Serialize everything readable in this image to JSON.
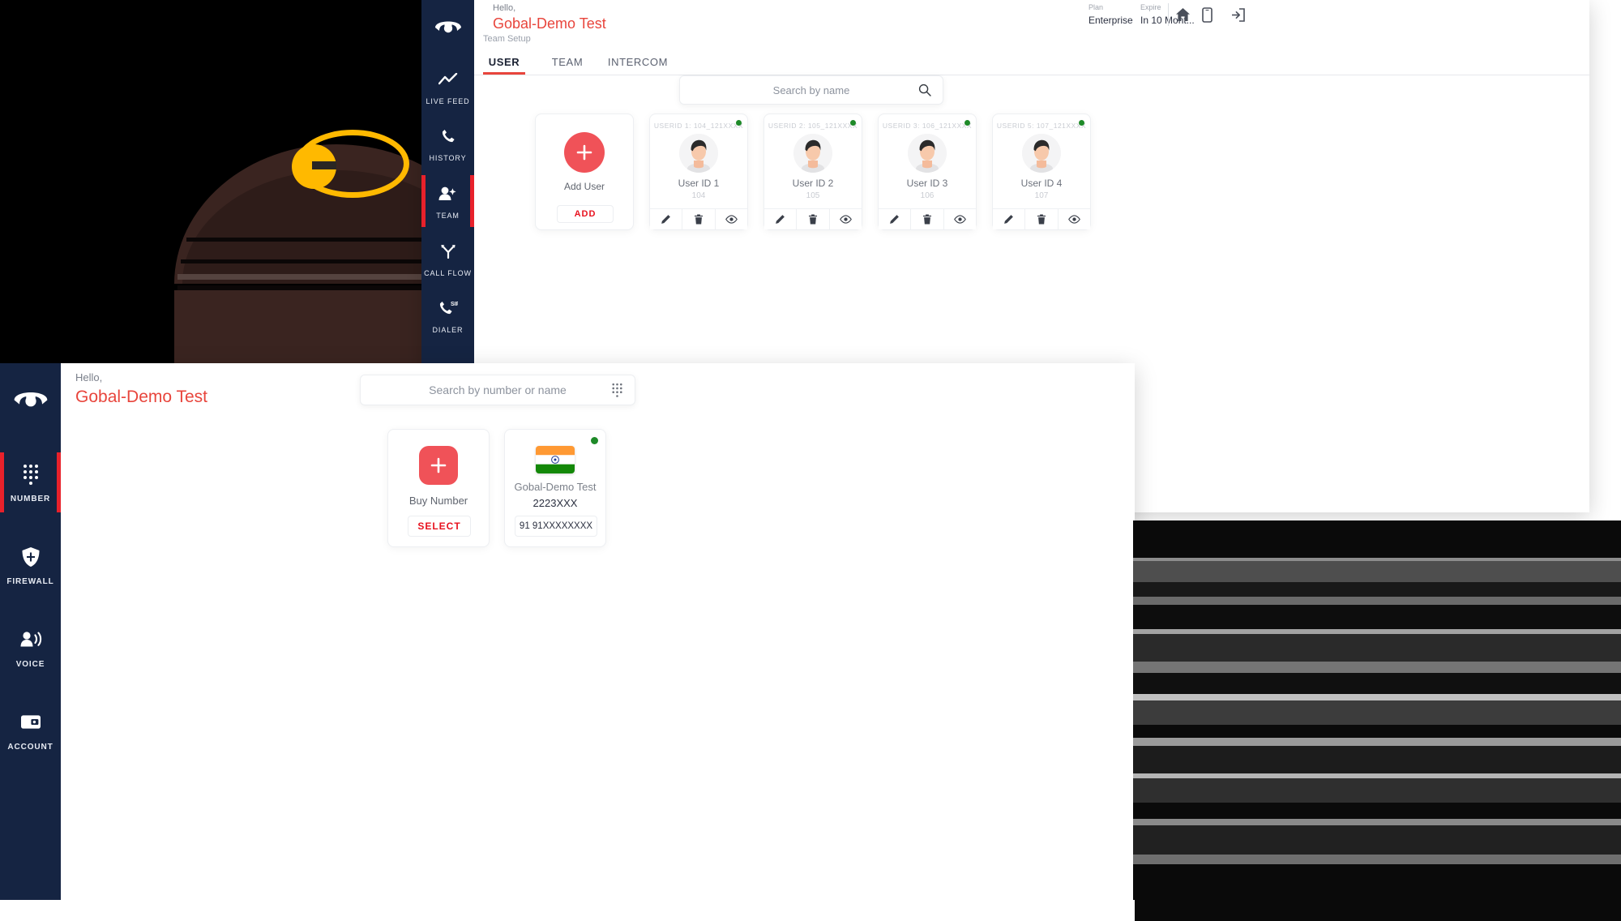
{
  "background_window": {
    "sidebar": {
      "logo_icon": "phone-hangup-icon",
      "items": [
        {
          "label": "LIVE FEED",
          "icon": "chart-line-icon",
          "active": false
        },
        {
          "label": "HISTORY",
          "icon": "phone-icon",
          "active": false
        },
        {
          "label": "TEAM",
          "icon": "user-add-icon",
          "active": true
        },
        {
          "label": "CALL FLOW",
          "icon": "call-flow-icon",
          "active": false
        },
        {
          "label": "DIALER",
          "icon": "sip-phone-icon",
          "active": false
        }
      ]
    },
    "header": {
      "greeting": "Hello,",
      "account_name": "Gobal-Demo Test",
      "plan_label": "Plan",
      "plan_value": "Enterprise",
      "expire_label": "Expire",
      "expire_value": "In 10 Mont...",
      "icons": [
        "home-icon",
        "mobile-icon",
        "logout-icon"
      ]
    },
    "section_label": "Team Setup",
    "tabs": [
      {
        "label": "USER",
        "active": true
      },
      {
        "label": "TEAM",
        "active": false
      },
      {
        "label": "INTERCOM",
        "active": false
      }
    ],
    "search": {
      "placeholder": "Search by name",
      "value": "",
      "icon": "search-icon"
    },
    "add_card": {
      "title": "Add User",
      "button_label": "ADD",
      "icon": "plus-icon"
    },
    "user_cards": [
      {
        "userid_line": "USERID 1: 104_121XXXX",
        "name": "User ID 1",
        "extension": "104",
        "online": true,
        "actions": [
          "edit-icon",
          "delete-icon",
          "view-icon"
        ]
      },
      {
        "userid_line": "USERID 2: 105_121XXXX",
        "name": "User ID 2",
        "extension": "105",
        "online": true,
        "actions": [
          "edit-icon",
          "delete-icon",
          "view-icon"
        ]
      },
      {
        "userid_line": "USERID 3: 106_121XXXX",
        "name": "User ID 3",
        "extension": "106",
        "online": true,
        "actions": [
          "edit-icon",
          "delete-icon",
          "view-icon"
        ]
      },
      {
        "userid_line": "USERID 5: 107_121XXXX",
        "name": "User ID 4",
        "extension": "107",
        "online": true,
        "actions": [
          "edit-icon",
          "delete-icon",
          "view-icon"
        ]
      }
    ]
  },
  "foreground_window": {
    "sidebar": {
      "logo_icon": "phone-hangup-icon",
      "items": [
        {
          "label": "NUMBER",
          "icon": "dialpad-icon",
          "active": true
        },
        {
          "label": "FIREWALL",
          "icon": "shield-icon",
          "active": false
        },
        {
          "label": "VOICE",
          "icon": "voice-icon",
          "active": false
        },
        {
          "label": "ACCOUNT",
          "icon": "wallet-icon",
          "active": false
        }
      ]
    },
    "header": {
      "greeting": "Hello,",
      "account_name": "Gobal-Demo Test"
    },
    "search": {
      "placeholder": "Search  by number or name",
      "value": "",
      "icon": "dialpad-icon"
    },
    "buy_card": {
      "title": "Buy Number",
      "button_label": "SELECT",
      "icon": "plus-icon"
    },
    "number_cards": [
      {
        "flag": "india-flag-icon",
        "name": "Gobal-Demo Test",
        "number": "2223XXX",
        "phone": "91 91XXXXXXXX",
        "online": true
      }
    ]
  },
  "annotation": {
    "shape": "ellipse-highlight",
    "color": "#FFB900",
    "target": "sidebar-item-team"
  },
  "colors": {
    "accent_red": "#e8453c",
    "sidebar_navy": "#152442",
    "online_green": "#1e8a28",
    "plus_coral": "#f05258",
    "annotation_yellow": "#FFB900"
  }
}
